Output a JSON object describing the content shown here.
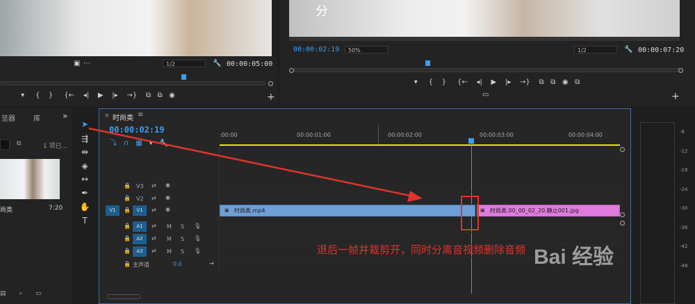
{
  "source_monitor": {
    "dropdown_zoom": "1/2",
    "timecode": "00:00:05:00"
  },
  "program_monitor": {
    "subtitle": "分",
    "timecode_current": "00:00:02:19",
    "zoom": "50%",
    "resolution": "1/2",
    "timecode_duration": "00:00:07:20"
  },
  "project_panel": {
    "tabs": [
      "览器",
      "库"
    ],
    "more": "»",
    "item_count": "1 项已...",
    "clip_name": "尚类",
    "clip_duration": "7:20"
  },
  "timeline": {
    "sequence_name": "时尚类",
    "menu_icon": "≡",
    "close": "×",
    "timecode": "00:00:02:19",
    "ruler": [
      ":00:00",
      "00:00:01:00",
      "00:00:02:00",
      "00:00:03:00",
      "00:00:04:00"
    ],
    "tracks": {
      "v3": "V3",
      "v2": "V2",
      "v1": "V1",
      "v1_src": "V1",
      "a1": "A1",
      "a2": "A2",
      "a3": "A3",
      "mute": "M",
      "solo": "S",
      "master": "主声道",
      "master_value": "0.0"
    },
    "clip_video1": "时尚类.mp4",
    "clip_video2": "时尚类.00_00_02_20.静止001.jpg"
  },
  "annotation": {
    "text": "退后一帧并裁剪开，同时分离音视频删除音频"
  },
  "meter": {
    "scale": [
      "-6",
      "-12",
      "-18",
      "-24",
      "-30",
      "-36",
      "-42",
      "-48"
    ]
  },
  "watermark": "Bai 经验",
  "colors": {
    "accent": "#3a9ff2",
    "video_clip": "#6e9fd6",
    "still_clip": "#e07adf",
    "annotation": "#e0342c",
    "work_area": "#e6e600"
  }
}
